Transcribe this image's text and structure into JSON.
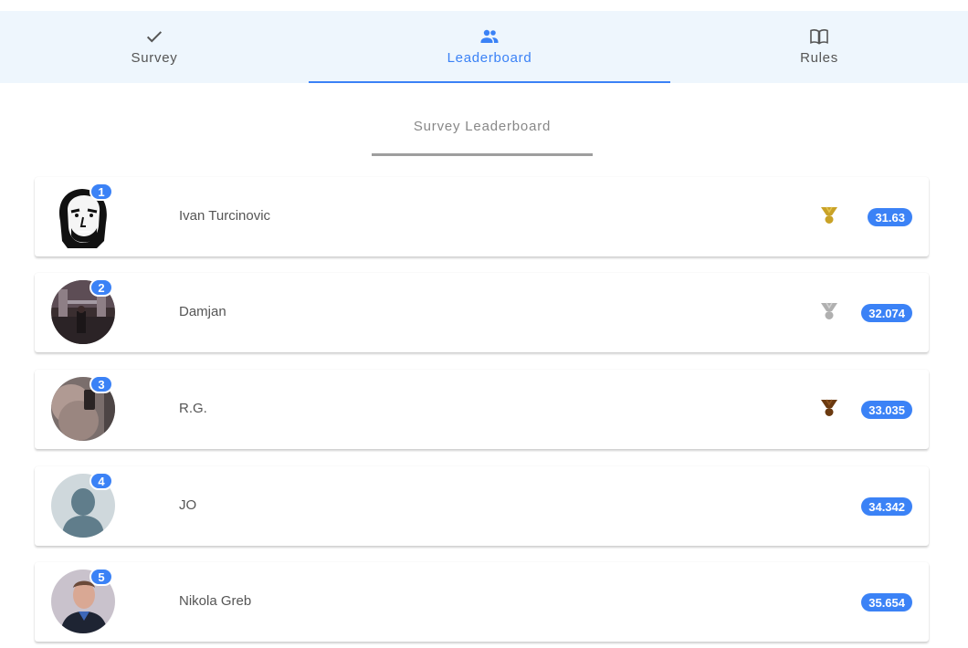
{
  "tabs": [
    {
      "label": "Survey",
      "icon": "check-icon",
      "active": false
    },
    {
      "label": "Leaderboard",
      "icon": "people-icon",
      "active": true
    },
    {
      "label": "Rules",
      "icon": "book-icon",
      "active": false
    }
  ],
  "section": {
    "title": "Survey Leaderboard"
  },
  "leaderboard": [
    {
      "rank": "1",
      "name": "Ivan Turcinovic",
      "score": "31.63",
      "medal": "gold",
      "avatar": "sketch-portrait"
    },
    {
      "rank": "2",
      "name": "Damjan",
      "score": "32.074",
      "medal": "silver",
      "avatar": "bridge-photo"
    },
    {
      "rank": "3",
      "name": "R.G.",
      "score": "33.035",
      "medal": "bronze",
      "avatar": "selfie-photo"
    },
    {
      "rank": "4",
      "name": "JO",
      "score": "34.342",
      "medal": "none",
      "avatar": "default-silhouette"
    },
    {
      "rank": "5",
      "name": "Nikola Greb",
      "score": "35.654",
      "medal": "none",
      "avatar": "portrait-photo"
    }
  ],
  "colors": {
    "accent": "#3b82f6",
    "tab_bg": "#eef6fd",
    "gold": "#c9a227",
    "silver": "#b0b0b0",
    "bronze": "#6b3a10"
  }
}
